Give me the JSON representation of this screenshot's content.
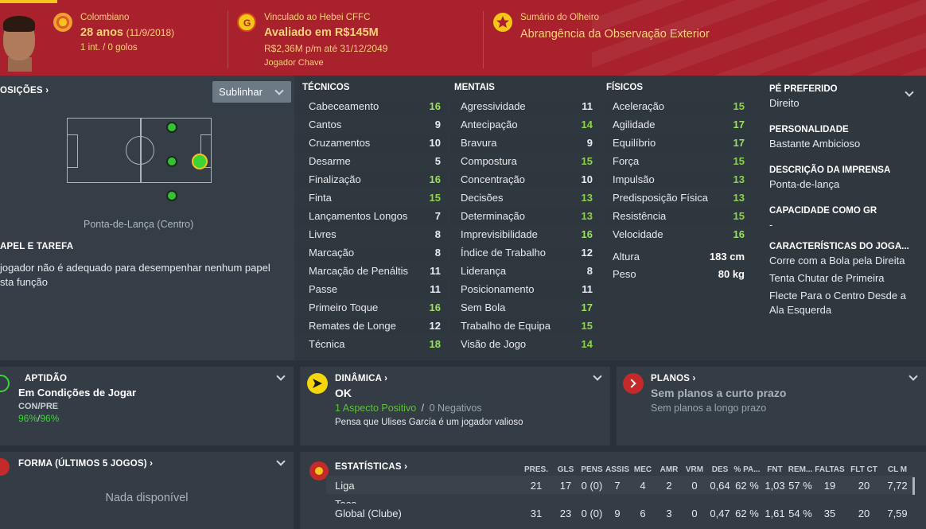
{
  "header": {
    "nationality": "Colombiano",
    "age": "28 anos",
    "birth_date": "(11/9/2018)",
    "intl": "1 int. / 0 golos",
    "club_contract": "Vinculado ao Hebei CFFC",
    "value": "Avaliado em R$145M",
    "wage": "R$2,36M p/m até 31/12/2049",
    "status": "Jogador Chave",
    "scout_title": "Sumário do Olheiro",
    "scout_value": "Abrangência da Observação Exterior"
  },
  "positions": {
    "title": "OSIÇÕES ›",
    "button": "Sublinhar",
    "position_label": "Ponta-de-Lança (Centro)"
  },
  "role": {
    "title": "APEL E TAREFA",
    "text1": "jogador não é adequado para desempenhar nenhum papel",
    "text2": "sta função"
  },
  "tecnicos": {
    "title": "TÉCNICOS",
    "rows": [
      {
        "name": "Cabeceamento",
        "value": "16"
      },
      {
        "name": "Cantos",
        "value": "9"
      },
      {
        "name": "Cruzamentos",
        "value": "10"
      },
      {
        "name": "Desarme",
        "value": "5"
      },
      {
        "name": "Finalização",
        "value": "16"
      },
      {
        "name": "Finta",
        "value": "15"
      },
      {
        "name": "Lançamentos Longos",
        "value": "7"
      },
      {
        "name": "Livres",
        "value": "8"
      },
      {
        "name": "Marcação",
        "value": "8"
      },
      {
        "name": "Marcação de Penáltis",
        "value": "11"
      },
      {
        "name": "Passe",
        "value": "11"
      },
      {
        "name": "Primeiro Toque",
        "value": "16"
      },
      {
        "name": "Remates de Longe",
        "value": "12"
      },
      {
        "name": "Técnica",
        "value": "18"
      }
    ]
  },
  "mentais": {
    "title": "MENTAIS",
    "rows": [
      {
        "name": "Agressividade",
        "value": "11"
      },
      {
        "name": "Antecipação",
        "value": "14"
      },
      {
        "name": "Bravura",
        "value": "9"
      },
      {
        "name": "Compostura",
        "value": "15"
      },
      {
        "name": "Concentração",
        "value": "10"
      },
      {
        "name": "Decisões",
        "value": "13"
      },
      {
        "name": "Determinação",
        "value": "13"
      },
      {
        "name": "Imprevisibilidade",
        "value": "16"
      },
      {
        "name": "Índice de Trabalho",
        "value": "12"
      },
      {
        "name": "Liderança",
        "value": "8"
      },
      {
        "name": "Posicionamento",
        "value": "11"
      },
      {
        "name": "Sem Bola",
        "value": "17"
      },
      {
        "name": "Trabalho de Equipa",
        "value": "15"
      },
      {
        "name": "Visão de Jogo",
        "value": "14"
      }
    ]
  },
  "fisicos": {
    "title": "FÍSICOS",
    "rows": [
      {
        "name": "Aceleração",
        "value": "15"
      },
      {
        "name": "Agilidade",
        "value": "17"
      },
      {
        "name": "Equilíbrio",
        "value": "17"
      },
      {
        "name": "Força",
        "value": "15"
      },
      {
        "name": "Impulsão",
        "value": "13"
      },
      {
        "name": "Predisposição Física",
        "value": "13"
      },
      {
        "name": "Resistência",
        "value": "15"
      },
      {
        "name": "Velocidade",
        "value": "16"
      }
    ],
    "height_label": "Altura",
    "height": "183 cm",
    "weight_label": "Peso",
    "weight": "80 kg"
  },
  "info": {
    "foot_title": "PÉ PREFERIDO",
    "foot": "Direito",
    "personality_title": "PERSONALIDADE",
    "personality": "Bastante Ambicioso",
    "press_title": "DESCRIÇÃO DA IMPRENSA",
    "press": "Ponta-de-lança",
    "gk_title": "CAPACIDADE COMO GR",
    "gk": "-",
    "traits_title": "CARACTERÍSTICAS DO JOGA...",
    "traits": [
      "Corre com a Bola pela Direita",
      "Tenta Chutar de Primeira",
      "Flecte Para o Centro Desde a",
      "Ala Esquerda"
    ]
  },
  "aptidao": {
    "title": "APTIDÃO",
    "value": "Em Condições de Jogar",
    "sub": "CON/PRE",
    "con": "96%",
    "pre": "96%",
    "slash": "/"
  },
  "dinamica": {
    "title": "DINÂMICA ›",
    "value": "OK",
    "positive": "1 Aspecto Positivo",
    "slash": "/",
    "negative": "0 Negativos",
    "note": "Pensa que Ulises García é um jogador valioso"
  },
  "planos": {
    "title": "PLANOS ›",
    "short": "Sem planos a curto prazo",
    "long": "Sem planos a longo prazo"
  },
  "forma": {
    "title": "FORMA (ÚLTIMOS 5 JOGOS) ›",
    "empty": "Nada disponível"
  },
  "estatisticas": {
    "title": "ESTATÍSTICAS ›",
    "columns": [
      "PRES.",
      "GLS",
      "PENS",
      "ASSIS",
      "MEC",
      "AMR",
      "VRM",
      "DES",
      "% PA...",
      "FNT",
      "REM...",
      "FALTAS",
      "FLT CT",
      "CL M"
    ],
    "rows": [
      {
        "label": "Liga",
        "values": [
          "21",
          "17",
          "0 (0)",
          "7",
          "4",
          "2",
          "0",
          "0,64",
          "62 %",
          "1,03",
          "57 %",
          "19",
          "20",
          "7,72"
        ]
      },
      {
        "label": "Taça",
        "values": []
      },
      {
        "label": "Global (Clube)",
        "values": [
          "31",
          "23",
          "0 (0)",
          "9",
          "6",
          "3",
          "0",
          "0,47",
          "62 %",
          "1,61",
          "54 %",
          "35",
          "20",
          "7,59"
        ]
      }
    ]
  }
}
